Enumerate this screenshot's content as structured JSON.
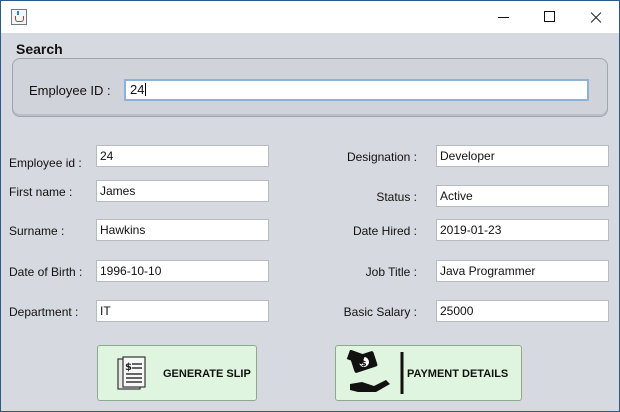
{
  "window": {
    "app_icon": "java-cup-icon",
    "controls": {
      "minimize": "minimize-icon",
      "maximize": "maximize-icon",
      "close": "close-icon"
    }
  },
  "search": {
    "title": "Search",
    "label": "Employee ID :",
    "value": "24"
  },
  "fields_left": [
    {
      "label": "Employee id :",
      "value": "24"
    },
    {
      "label": "First name :",
      "value": "James"
    },
    {
      "label": "Surname :",
      "value": "Hawkins"
    },
    {
      "label": "Date of Birth :",
      "value": "1996-10-10"
    },
    {
      "label": "Department :",
      "value": "IT"
    }
  ],
  "fields_right": [
    {
      "label": "Designation :",
      "value": "Developer"
    },
    {
      "label": "Status :",
      "value": "Active"
    },
    {
      "label": "Date Hired :",
      "value": "2019-01-23"
    },
    {
      "label": "Job Title :",
      "value": "Java Programmer"
    },
    {
      "label": "Basic Salary :",
      "value": "25000"
    }
  ],
  "buttons": {
    "generate_slip": {
      "label": "GENERATE SLIP",
      "icon": "receipt-icon"
    },
    "payment_details": {
      "label": "PAYMENT DETAILS",
      "icon": "hand-money-icon"
    }
  },
  "colors": {
    "window_bg": "#d6d9df",
    "button_bg": "#dff5df",
    "input_focus_border": "#8fb0d8"
  }
}
